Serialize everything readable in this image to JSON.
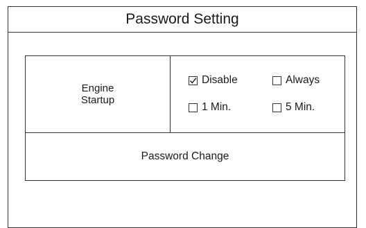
{
  "window": {
    "title": "Password Setting"
  },
  "engine_startup": {
    "label_line1": "Engine",
    "label_line2": "Startup",
    "options": [
      {
        "label": "Disable",
        "checked": true
      },
      {
        "label": "Always",
        "checked": false
      },
      {
        "label": "1 Min.",
        "checked": false
      },
      {
        "label": "5 Min.",
        "checked": false
      }
    ]
  },
  "password_change": {
    "label": "Password Change"
  }
}
